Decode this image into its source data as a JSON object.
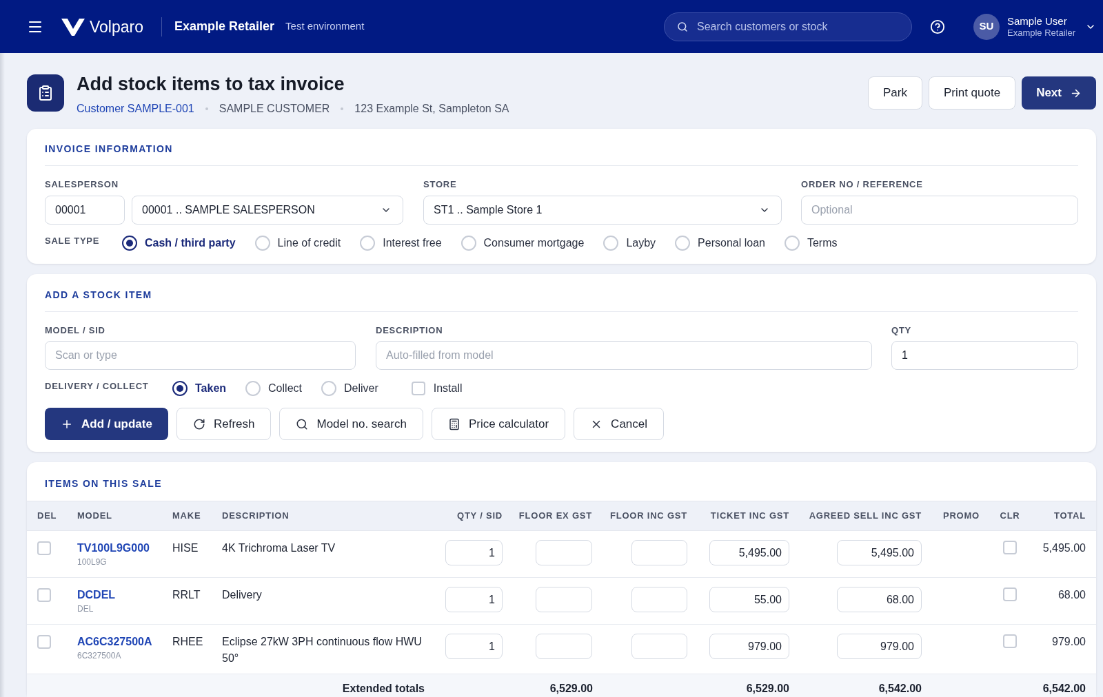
{
  "top_bar": {
    "brand": "Volparo",
    "company": "Example Retailer",
    "environment": "Test environment",
    "search": {
      "placeholder": "Search customers or stock"
    },
    "user": {
      "initials": "SU",
      "name": "Sample User",
      "company": "Example Retailer"
    }
  },
  "page_header": {
    "title": "Add stock items to tax invoice",
    "customer_link": "Customer SAMPLE-001",
    "customer_name": "SAMPLE CUSTOMER",
    "address": "123 Example St, Sampleton SA",
    "actions": [
      {
        "label": "Park",
        "kind": "secondary"
      },
      {
        "label": "Print quote",
        "kind": "secondary"
      },
      {
        "label": "Next",
        "kind": "primary"
      }
    ]
  },
  "invoice_information": {
    "heading": "INVOICE INFORMATION",
    "salesperson": {
      "label": "SALESPERSON",
      "code": "00001",
      "value": "00001 .. SAMPLE SALESPERSON"
    },
    "store": {
      "label": "STORE",
      "value": "ST1 .. Sample Store 1"
    },
    "order_reference": {
      "label": "ORDER NO / REFERENCE",
      "placeholder": "Optional"
    },
    "sale_type": {
      "label": "SALE TYPE",
      "options": [
        {
          "label": "Cash / third party",
          "selected": true
        },
        {
          "label": "Line of credit",
          "selected": false
        },
        {
          "label": "Interest free",
          "selected": false
        },
        {
          "label": "Consumer mortgage",
          "selected": false
        },
        {
          "label": "Layby",
          "selected": false
        },
        {
          "label": "Personal loan",
          "selected": false
        },
        {
          "label": "Terms",
          "selected": false
        }
      ]
    }
  },
  "add_stock_item": {
    "heading": "ADD A STOCK ITEM",
    "model": {
      "label": "MODEL / SID",
      "placeholder": "Scan or type"
    },
    "description": {
      "label": "DESCRIPTION",
      "placeholder": "Auto-filled from model"
    },
    "qty": {
      "label": "QTY",
      "value": "1"
    },
    "delivery": {
      "label": "DELIVERY / COLLECT",
      "options": [
        {
          "label": "Taken",
          "kind": "radio",
          "selected": true
        },
        {
          "label": "Collect",
          "kind": "radio",
          "selected": false
        },
        {
          "label": "Deliver",
          "kind": "radio",
          "selected": false
        },
        {
          "label": "Install",
          "kind": "checkbox",
          "checked": false
        }
      ]
    },
    "buttons": [
      {
        "label": "Add / update",
        "kind": "primary"
      },
      {
        "label": "Refresh",
        "kind": "secondary"
      },
      {
        "label": "Model no. search",
        "kind": "secondary"
      },
      {
        "label": "Price calculator",
        "kind": "secondary"
      },
      {
        "label": "Cancel",
        "kind": "secondary"
      }
    ]
  },
  "items_on_sale": {
    "heading": "ITEMS ON THIS SALE",
    "columns": [
      "DEL",
      "MODEL",
      "MAKE",
      "DESCRIPTION",
      "QTY / SID",
      "FLOOR EX GST",
      "FLOOR INC GST",
      "TICKET INC GST",
      "AGREED SELL INC GST",
      "PROMO",
      "CLR",
      "TOTAL"
    ],
    "rows": [
      {
        "del": false,
        "model": "TV100L9G000",
        "sid": "100L9G",
        "make": "HISE",
        "description": "4K Trichroma Laser TV",
        "qty": "1",
        "ticket_inc_gst": "5,495.00",
        "agreed_sell_inc_gst": "5,495.00",
        "clr": false,
        "total": "5,495.00"
      },
      {
        "del": false,
        "model": "DCDEL",
        "sid": "DEL",
        "make": "RRLT",
        "description": "Delivery",
        "qty": "1",
        "ticket_inc_gst": "55.00",
        "agreed_sell_inc_gst": "68.00",
        "clr": false,
        "total": "68.00"
      },
      {
        "del": false,
        "model": "AC6C327500A",
        "sid": "6C327500A",
        "make": "RHEE",
        "description": "Eclipse 27kW 3PH continuous flow HWU 50°",
        "qty": "1",
        "ticket_inc_gst": "979.00",
        "agreed_sell_inc_gst": "979.00",
        "clr": false,
        "total": "979.00"
      }
    ],
    "totals": {
      "label": "Extended totals",
      "floor_ex_gst": "6,529.00",
      "ticket_inc_gst": "6,529.00",
      "agreed_sell_inc_gst": "6,542.00",
      "total": "6,542.00"
    }
  }
}
